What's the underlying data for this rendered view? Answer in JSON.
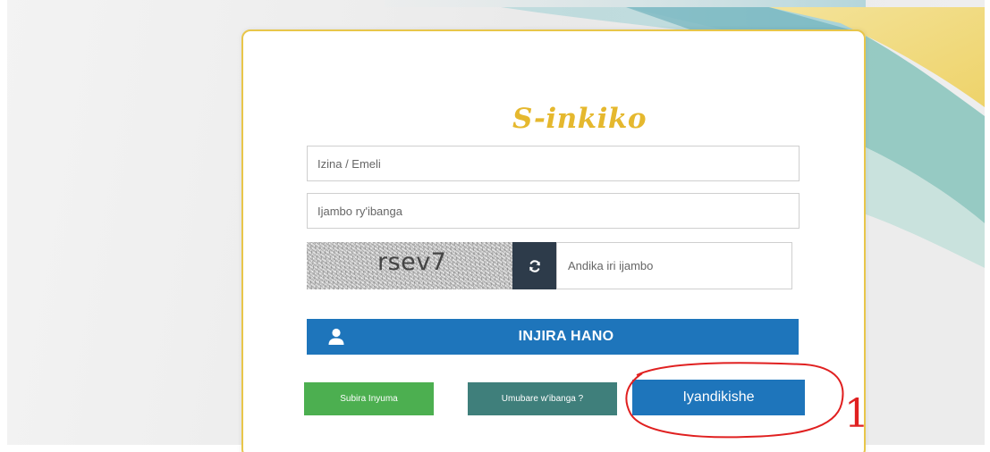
{
  "app": {
    "title": "S-inkiko"
  },
  "form": {
    "username_placeholder": "Izina / Emeli",
    "password_placeholder": "Ijambo ry'ibanga",
    "captcha_text": "rsev7",
    "captcha_placeholder": "Andika iri ijambo",
    "login_label": "INJIRA HANO"
  },
  "actions": {
    "back_label": "Subira Inyuma",
    "forgot_label": "Umubare w'ibanga ?",
    "register_label": "Iyandikishe"
  },
  "annotation": {
    "label": "1",
    "color": "#e02020"
  },
  "icons": {
    "refresh": "refresh-icon",
    "user": "user-icon"
  },
  "colors": {
    "title": "#e5b82e",
    "primary": "#1e75bb",
    "back": "#4caf50",
    "forgot": "#3f7f7b",
    "refresh_bg": "#2d3b4a",
    "card_border": "#e8c64a"
  }
}
